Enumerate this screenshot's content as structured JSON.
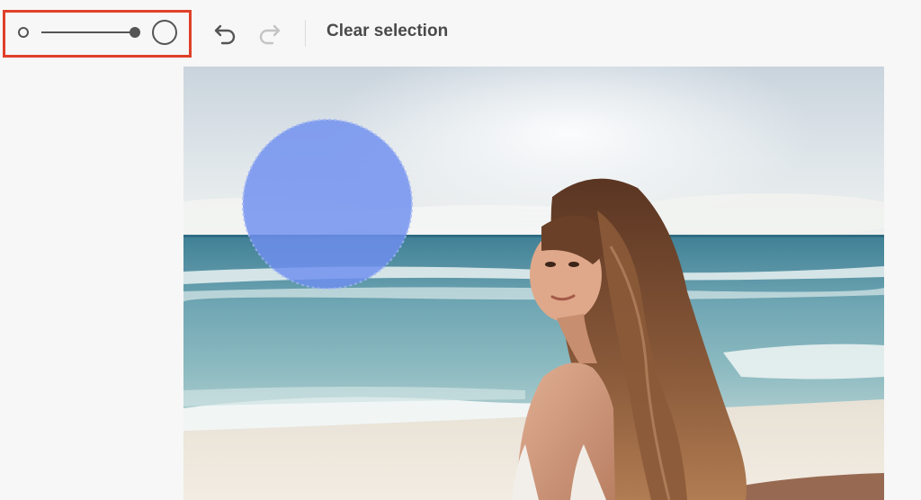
{
  "toolbar": {
    "clear_selection_label": "Clear selection",
    "undo_enabled": true,
    "redo_enabled": false
  },
  "brush_size": {
    "min_icon": "small-circle-icon",
    "max_icon": "large-circle-icon",
    "value_fraction": 1.0
  },
  "colors": {
    "highlight_border": "#e0402a",
    "selection_fill": "#6f8ff0",
    "icon_active": "#555555",
    "icon_disabled": "#c4c4c4",
    "label_text": "#4a4a4a"
  }
}
